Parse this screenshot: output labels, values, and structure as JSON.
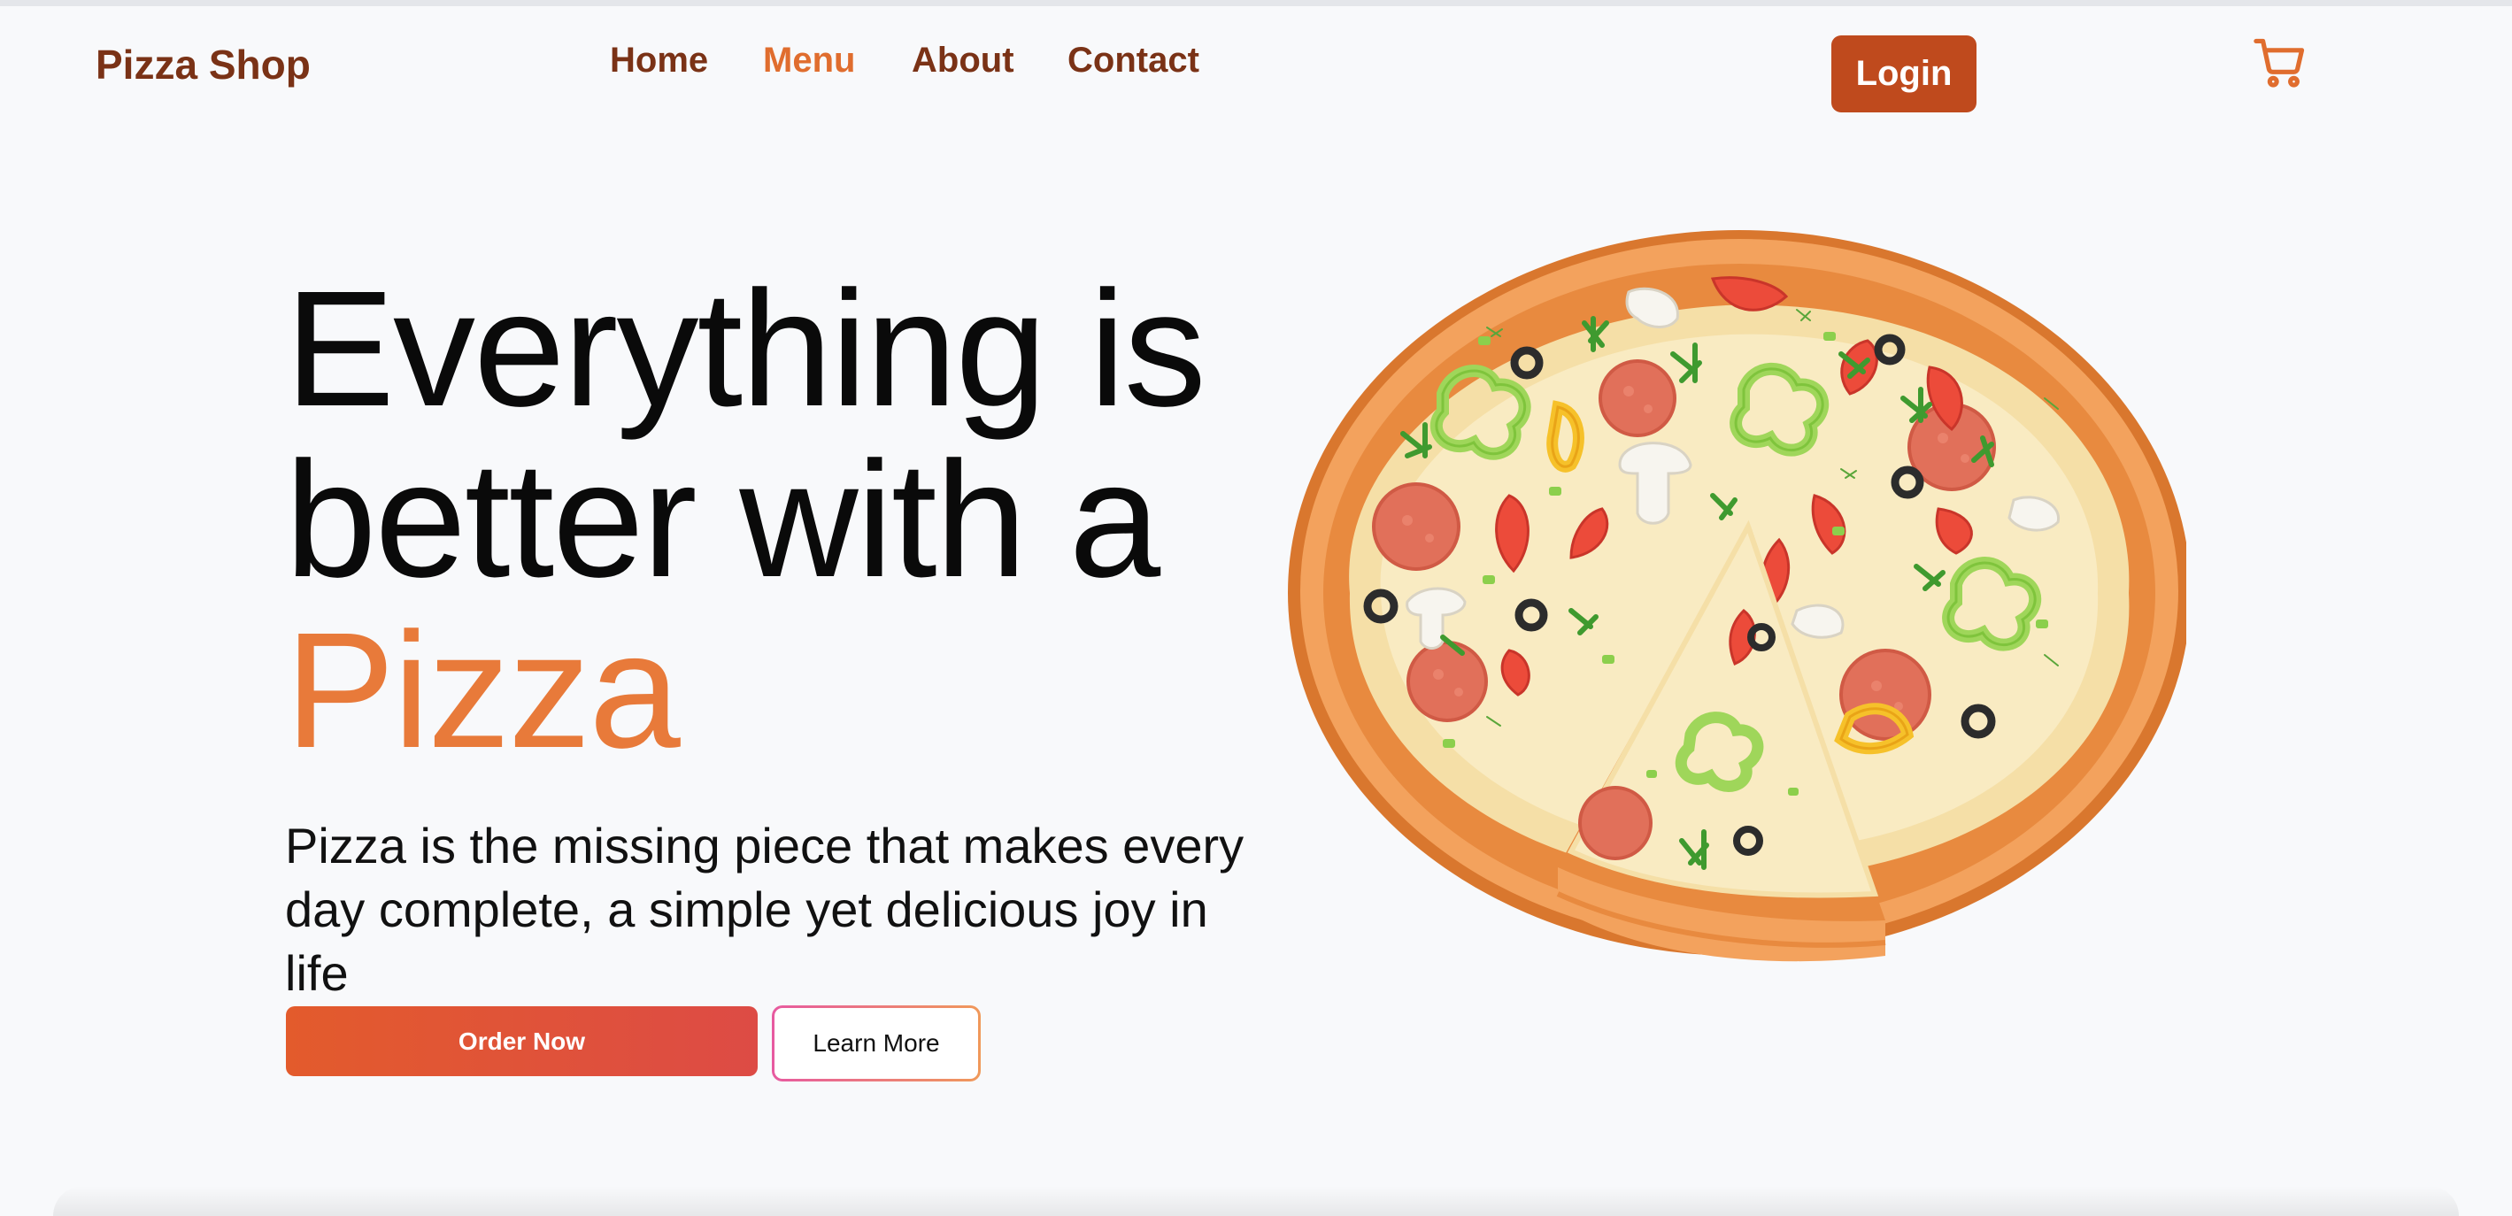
{
  "header": {
    "brand": "Pizza Shop",
    "nav": [
      {
        "label": "Home",
        "active": false
      },
      {
        "label": "Menu",
        "active": true
      },
      {
        "label": "About",
        "active": false
      },
      {
        "label": "Contact",
        "active": false
      }
    ],
    "login_label": "Login",
    "cart_icon": "shopping-cart-icon"
  },
  "hero": {
    "title_line1": "Everything is",
    "title_line2": "better with a",
    "title_accent": "Pizza",
    "description": "Pizza is the missing piece that makes every day complete, a simple yet delicious joy in life",
    "primary_button": "Order Now",
    "secondary_button": "Learn More",
    "image_icon": "pizza-illustration"
  },
  "colors": {
    "brand": "#7a3216",
    "accent": "#e06d2e",
    "login_bg": "#bf4a1d",
    "title_accent": "#e87a3a",
    "background": "#f8f9fb"
  }
}
